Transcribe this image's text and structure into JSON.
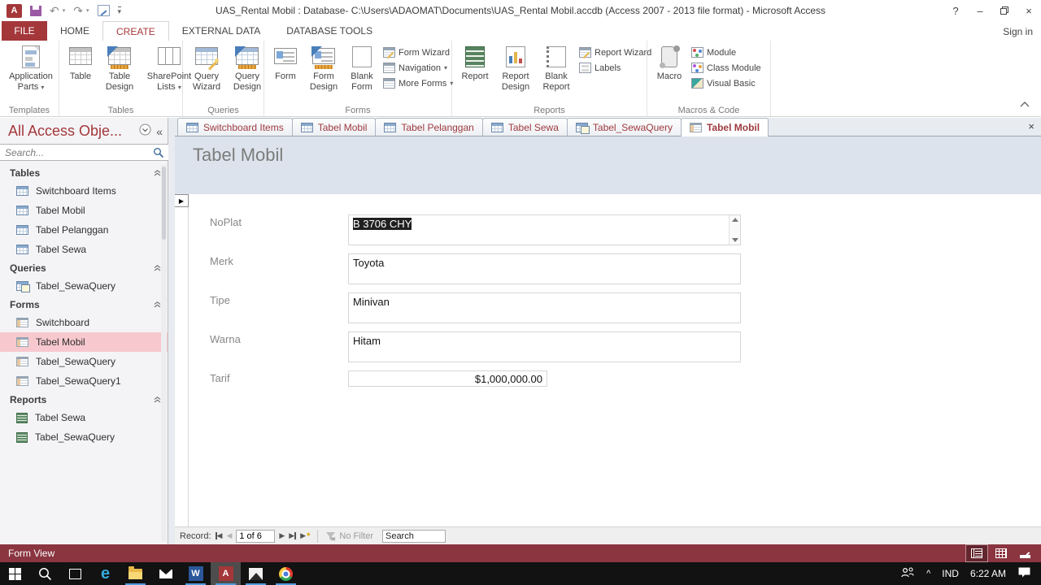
{
  "colors": {
    "accent": "#A4373A",
    "status_bar": "#8a3540",
    "selection_bg": "#f7c9ce",
    "taskbar_underline": "#4f9ddf"
  },
  "titlebar": {
    "title": "UAS_Rental Mobil : Database- C:\\Users\\ADAOMAT\\Documents\\UAS_Rental Mobil.accdb (Access 2007 - 2013 file format) - Microsoft Access",
    "sign_in": "Sign in"
  },
  "ribbon_tabs": {
    "file": "FILE",
    "home": "HOME",
    "create": "CREATE",
    "external": "EXTERNAL DATA",
    "dbtools": "DATABASE TOOLS"
  },
  "ribbon": {
    "templates": {
      "label": "Templates",
      "app_parts": "Application Parts"
    },
    "tables": {
      "label": "Tables",
      "table": "Table",
      "table_design": "Table Design",
      "sharepoint": "SharePoint Lists"
    },
    "queries": {
      "label": "Queries",
      "wizard": "Query Wizard",
      "design": "Query Design"
    },
    "forms": {
      "label": "Forms",
      "form": "Form",
      "form_design": "Form Design",
      "blank": "Blank Form",
      "wizard": "Form Wizard",
      "navigation": "Navigation",
      "more": "More Forms"
    },
    "reports": {
      "label": "Reports",
      "report": "Report",
      "report_design": "Report Design",
      "blank": "Blank Report",
      "wizard": "Report Wizard",
      "labels": "Labels"
    },
    "macros": {
      "label": "Macros & Code",
      "macro": "Macro",
      "module": "Module",
      "class_module": "Class Module",
      "vb": "Visual Basic"
    }
  },
  "nav_pane": {
    "title": "All Access Obje...",
    "search_placeholder": "Search...",
    "sections": {
      "tables": {
        "label": "Tables",
        "items": [
          "Switchboard Items",
          "Tabel Mobil",
          "Tabel Pelanggan",
          "Tabel Sewa"
        ]
      },
      "queries": {
        "label": "Queries",
        "items": [
          "Tabel_SewaQuery"
        ]
      },
      "forms": {
        "label": "Forms",
        "items": [
          "Switchboard",
          "Tabel Mobil",
          "Tabel_SewaQuery",
          "Tabel_SewaQuery1"
        ]
      },
      "reports": {
        "label": "Reports",
        "items": [
          "Tabel Sewa",
          "Tabel_SewaQuery"
        ]
      }
    }
  },
  "doc_tabs": {
    "tabs": [
      "Switchboard Items",
      "Tabel Mobil",
      "Tabel Pelanggan",
      "Tabel Sewa",
      "Tabel_SewaQuery",
      "Tabel Mobil"
    ]
  },
  "form": {
    "title": "Tabel Mobil",
    "fields": [
      {
        "label": "NoPlat",
        "value": "B 3706 CHY"
      },
      {
        "label": "Merk",
        "value": "Toyota"
      },
      {
        "label": "Tipe",
        "value": "Minivan"
      },
      {
        "label": "Warna",
        "value": "Hitam"
      },
      {
        "label": "Tarif",
        "value": "$1,000,000.00"
      }
    ]
  },
  "record_nav": {
    "label": "Record:",
    "position": "1 of 6",
    "no_filter": "No Filter",
    "search_placeholder": "Search"
  },
  "status_bar": {
    "view": "Form View"
  },
  "taskbar": {
    "language": "IND",
    "time": "6:22 AM"
  },
  "glyphs": {
    "dropdown": "▾",
    "undo": "↶",
    "redo": "↷",
    "collapse_pane": "«",
    "prev": "◀",
    "next": "▶",
    "new_star": "*",
    "marker": "▶",
    "close_tab": "×",
    "help": "?",
    "minimize": "–",
    "close": "×",
    "tray_up": "^"
  }
}
